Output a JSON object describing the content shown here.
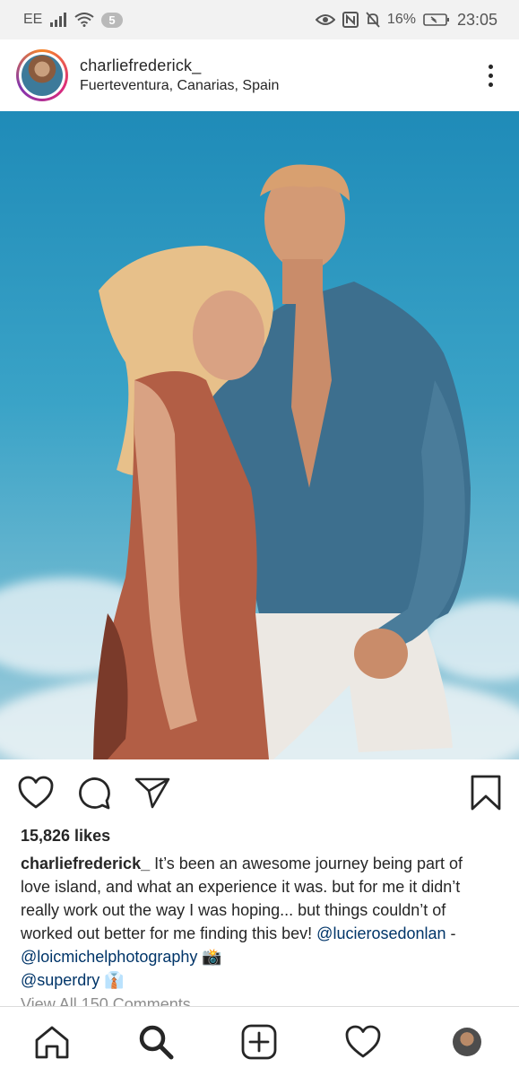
{
  "status_bar": {
    "carrier": "EE",
    "notification_count": "5",
    "battery": "16%",
    "time": "23:05",
    "icons": [
      "signal-icon",
      "wifi-icon",
      "eye-icon",
      "nfc-icon",
      "bell-muted-icon",
      "battery-icon"
    ]
  },
  "post": {
    "username": "charliefrederick_",
    "location": "Fuerteventura, Canarias, Spain",
    "likes": "15,826 likes",
    "caption": {
      "user": "charliefrederick_",
      "text": " It’s been an awesome journey being part of love island, and what an experience it was. but for me it didn’t really work out the way I was hoping... but things couldn’t of worked out better for me finding this bev! ",
      "mention1": "@lucierosedonlan",
      "separator": " - ",
      "mention2": "@loicmichelphotography",
      "emoji1": " 📸",
      "mention3": "@superdry",
      "emoji2": " 👔"
    },
    "view_comments": "View All 150 Comments"
  },
  "actions": [
    "heart-icon",
    "comment-icon",
    "share-icon",
    "bookmark-icon"
  ],
  "bottom_nav": [
    "home-icon",
    "search-icon",
    "add-post-icon",
    "activity-heart-icon",
    "profile-avatar"
  ]
}
